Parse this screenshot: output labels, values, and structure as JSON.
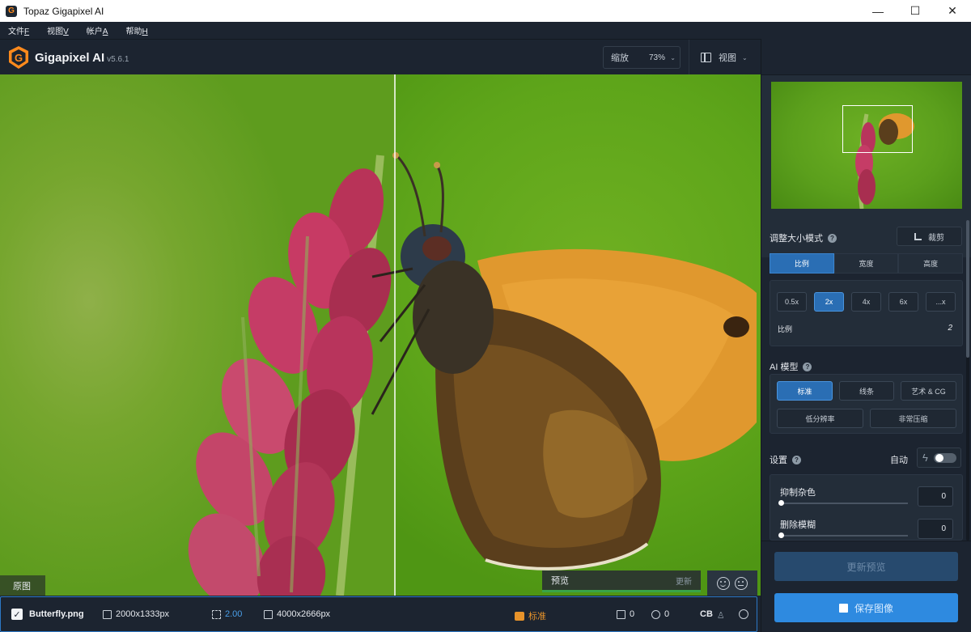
{
  "window": {
    "title": "Topaz Gigapixel AI",
    "app_icon": "G",
    "minimize": "—",
    "maximize": "☐",
    "close": "✕"
  },
  "menu": [
    {
      "label": "文件",
      "key": "F"
    },
    {
      "label": "视图",
      "key": "V"
    },
    {
      "label": "帐户",
      "key": "A"
    },
    {
      "label": "帮助",
      "key": "H"
    }
  ],
  "header": {
    "brand": "Gigapixel AI",
    "version": "v5.6.1",
    "zoom_label": "缩放",
    "zoom_value": "73%",
    "view_label": "视图"
  },
  "canvas": {
    "original_tag": "原图",
    "preview_label": "预览",
    "update_label": "更新"
  },
  "file_bar": {
    "filename": "Butterfly.png",
    "source_size": "2000x1333px",
    "scale": "2.00",
    "output_size": "4000x2666px",
    "model": "标准",
    "noise_value": "0",
    "blur_value": "0",
    "cb_label": "CB"
  },
  "sidebar": {
    "resize_title": "调整大小模式",
    "crop_label": "裁剪",
    "resize_tabs": [
      {
        "label": "比例",
        "active": true
      },
      {
        "label": "宽度",
        "active": false
      },
      {
        "label": "高度",
        "active": false
      }
    ],
    "scale_buttons": [
      {
        "label": "0.5x",
        "active": false
      },
      {
        "label": "2x",
        "active": true
      },
      {
        "label": "4x",
        "active": false
      },
      {
        "label": "6x",
        "active": false
      },
      {
        "label": "...x",
        "active": false
      }
    ],
    "scale_label": "比例",
    "scale_value": "2",
    "model_title": "AI 模型",
    "models": [
      {
        "label": "标准",
        "active": true
      },
      {
        "label": "线条",
        "active": false
      },
      {
        "label": "艺术 & CG",
        "active": false
      },
      {
        "label": "低分辨率",
        "active": false
      },
      {
        "label": "非常压缩",
        "active": false
      }
    ],
    "settings_title": "设置",
    "auto_label": "自动",
    "auto_enabled": false,
    "suppress_noise_label": "抑制杂色",
    "suppress_noise_value": "0",
    "remove_blur_label": "删除模糊",
    "remove_blur_value": "0",
    "update_preview": "更新预览",
    "save_image": "保存图像"
  },
  "colors": {
    "accent": "#2e8ae0",
    "active": "#2a6eb4",
    "brand_orange": "#ff8a1c",
    "model_orange": "#e7932a",
    "preview_green": "#3aa348"
  }
}
